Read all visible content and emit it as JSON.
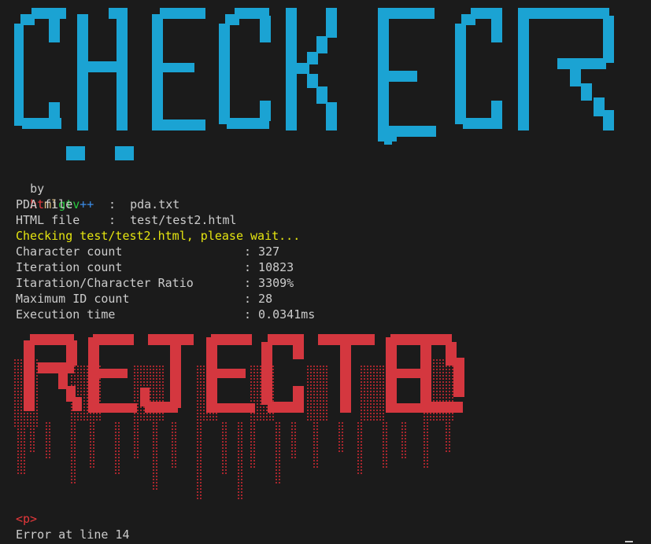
{
  "banners": {
    "top_word": "CHECKER",
    "top_color": "#1ba3d3",
    "bottom_word": "REJECTED",
    "bottom_color": "#d4373f"
  },
  "byline": {
    "prefix": "by",
    "author_parts": [
      "ht",
      "ml",
      "gtv",
      "++"
    ],
    "author_colors": [
      "#e5383b",
      "#e5c07b",
      "#27c93f",
      "#3b8eea"
    ]
  },
  "files": [
    {
      "label": "PDA file",
      "sep": ":",
      "value": "pda.txt"
    },
    {
      "label": "HTML file",
      "sep": ":",
      "value": "test/test2.html"
    }
  ],
  "status_message": "Checking test/test2.html, please wait...",
  "stats": [
    {
      "label": "Character count",
      "value": ": 327"
    },
    {
      "label": "Iteration count",
      "value": ": 10823"
    },
    {
      "label": "Itaration/Character Ratio",
      "value": ": 3309%"
    },
    {
      "label": "Maximum ID count",
      "value": ": 28"
    },
    {
      "label": "Execution time",
      "value": ": 0.0341ms"
    }
  ],
  "error": {
    "tag": "<p>",
    "message": "Error at line 14"
  }
}
